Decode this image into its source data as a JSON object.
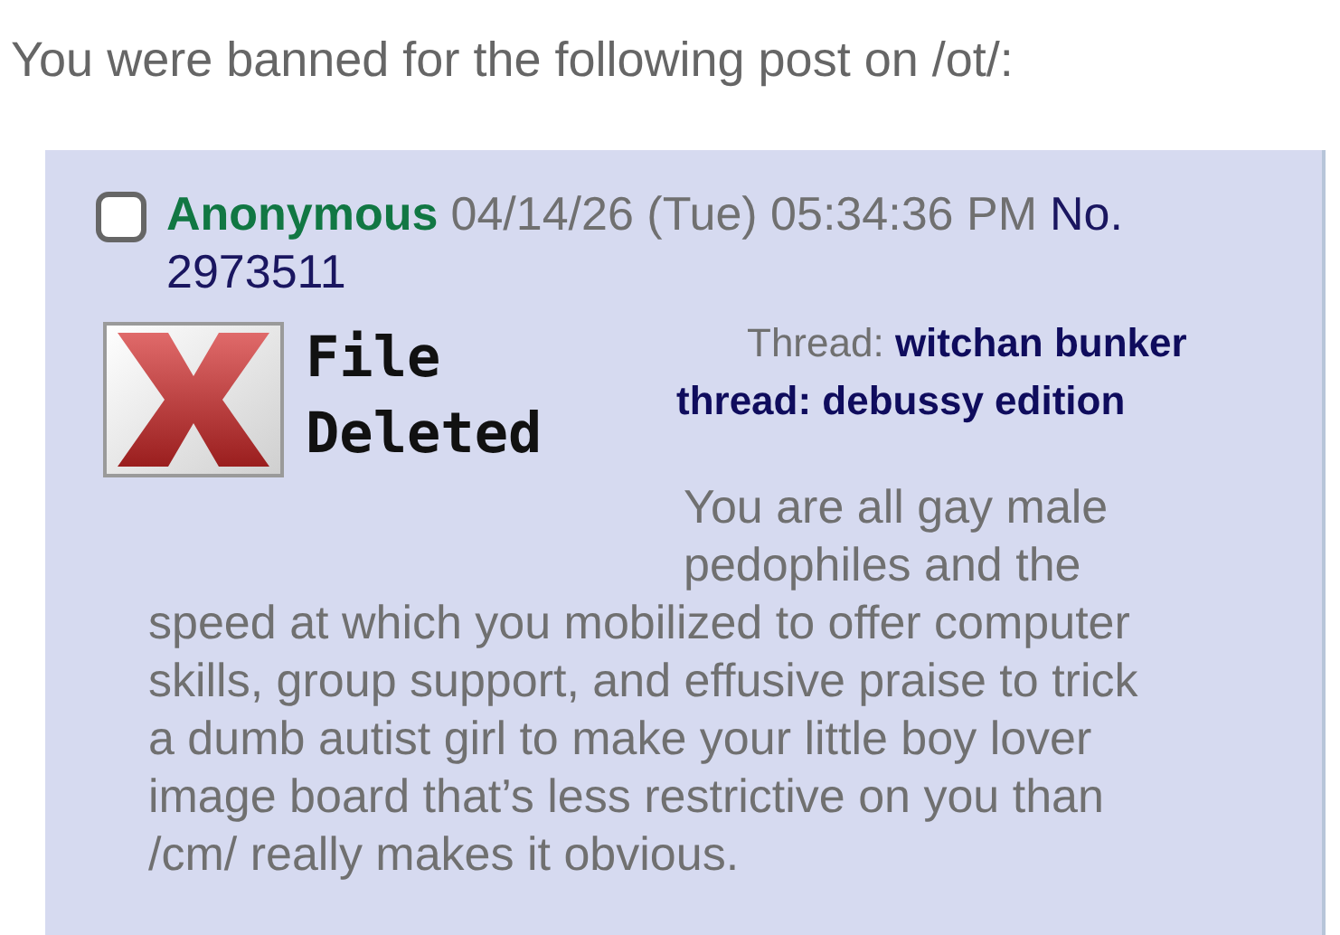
{
  "notice": "You were banned for the following post on /ot/:",
  "post": {
    "selected": false,
    "name": "Anonymous",
    "datetime": "04/14/26 (Tue) 05:34:36 PM",
    "number_label": "No.",
    "number": "2973511",
    "file_label": "File Deleted",
    "thread": "Thread: **witchan bunker thread: debussy edition**",
    "message": "You are all gay male pedophiles and the speed at which you mobilized to offer computer skills, group support, and effusive praise to trick a dumb autist girl to make your little boy lover image board that’s less restrictive on you than /cm/ really makes it obvious."
  }
}
